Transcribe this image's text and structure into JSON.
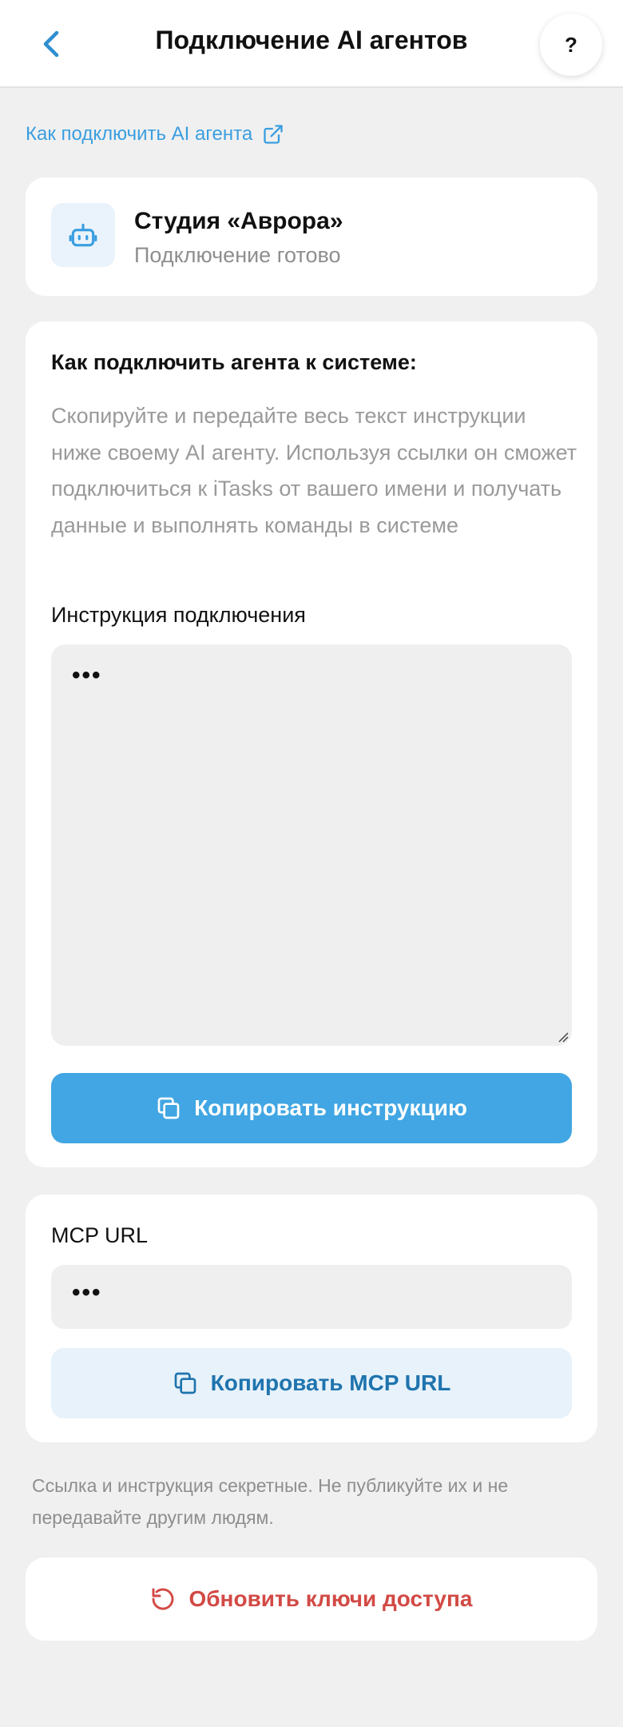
{
  "header": {
    "title": "Подключение AI агентов",
    "back_icon": "chevron-left-icon",
    "help_label": "?"
  },
  "howto_link": {
    "label": "Как подключить AI агента",
    "icon": "external-link-icon"
  },
  "workspace": {
    "icon": "robot-icon",
    "name": "Студия «Аврора»",
    "status": "Подключение готово"
  },
  "instructions": {
    "title": "Как подключить агента к системе:",
    "description": "Скопируйте и передайте весь текст инструкции ниже своему AI агенту. Используя ссылки он сможет подключиться к iTasks от вашего имени и получать данные и выполнять команды в системе",
    "label": "Инструкция подключения",
    "value": "•••",
    "copy_button": "Копировать инструкцию",
    "copy_icon": "copy-icon"
  },
  "mcp": {
    "label": "MCP URL",
    "value": "•••",
    "copy_button": "Копировать MCP URL",
    "copy_icon": "copy-icon"
  },
  "secret_note": "Ссылка и инструкция секретные. Не публикуйте их и не передавайте другим людям.",
  "refresh": {
    "label": "Обновить ключи доступа",
    "icon": "refresh-icon"
  },
  "colors": {
    "accent": "#41a6e3",
    "link": "#3a9ee0",
    "secondary_button_bg": "#e7f2fa",
    "secondary_button_text": "#1f74ae",
    "danger": "#d24a45",
    "background": "#f0f0f0",
    "muted_text": "#9a9a9a"
  }
}
